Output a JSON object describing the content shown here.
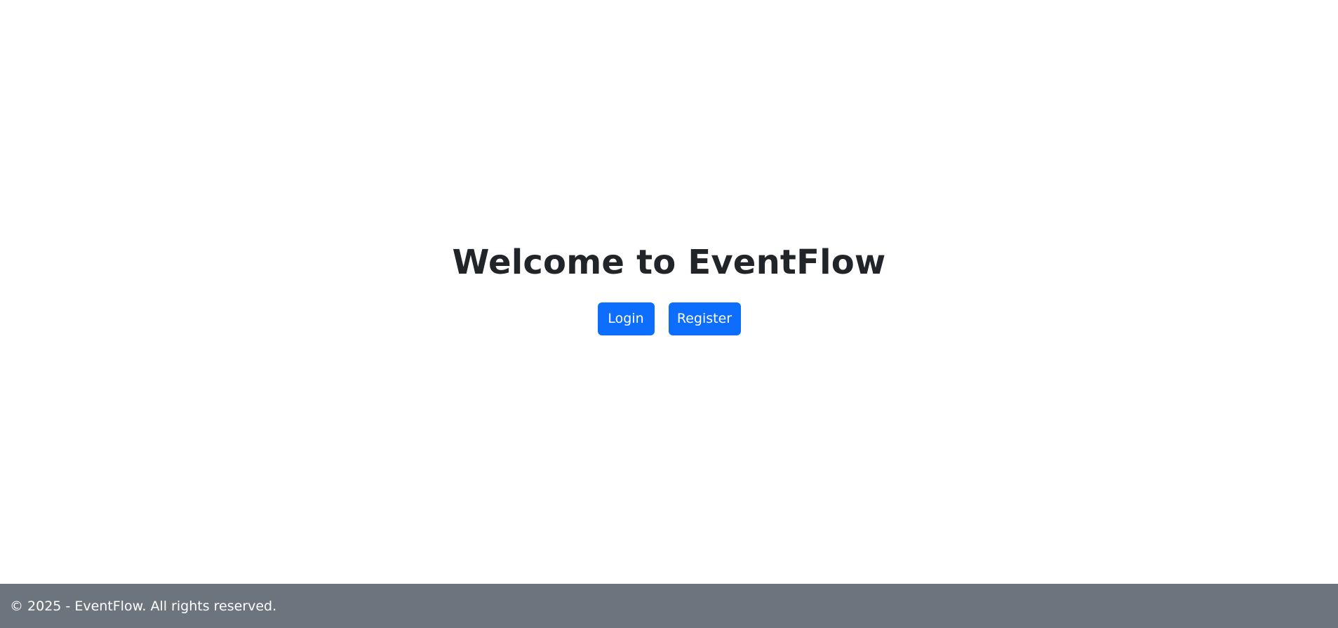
{
  "hero": {
    "title": "Welcome to EventFlow",
    "login_label": "Login",
    "register_label": "Register"
  },
  "footer": {
    "text": "© 2025 - EventFlow. All rights reserved."
  },
  "colors": {
    "primary": "#0d6efd",
    "footer_bg": "#6c757d",
    "title_text": "#212529",
    "background": "#ffffff"
  }
}
